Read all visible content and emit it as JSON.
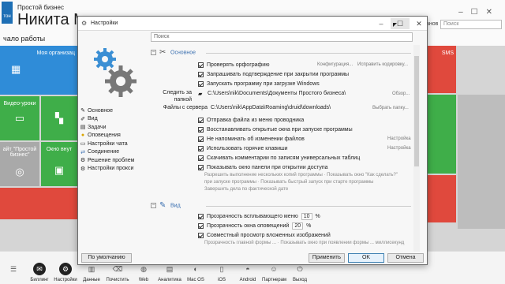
{
  "app": {
    "subtitle": "Простой бизнес",
    "name": "Никита М",
    "start": "чало работы",
    "logo_text": "тон",
    "side_label": "анов",
    "side_search": "Поиск"
  },
  "tiles": {
    "org": "Моя организац",
    "video": "Видео-уроки",
    "about": "айт \"Простой бизнес\"",
    "window": "Окно внут",
    "sms": "SMS"
  },
  "taskbar": [
    "Биллинг",
    "Настройки",
    "Данные",
    "Почистить",
    "Web",
    "Аналитика",
    "Mac OS",
    "iOS",
    "Android",
    "Партнерам",
    "Выход"
  ],
  "dialog": {
    "title": "Настройки",
    "search_placeholder": "Поиск",
    "nav": [
      {
        "label": "Основное",
        "icon": "wrench-icon"
      },
      {
        "label": "Вид",
        "icon": "brush-icon"
      },
      {
        "label": "Задачи",
        "icon": "task-icon"
      },
      {
        "label": "Оповещения",
        "icon": "bell-icon"
      },
      {
        "label": "Настройки чата",
        "icon": "chat-icon"
      },
      {
        "label": "Соединение",
        "icon": "connection-icon"
      },
      {
        "label": "Решение проблем",
        "icon": "gear-icon"
      },
      {
        "label": "Настройки прокси",
        "icon": "proxy-icon"
      }
    ],
    "sections": {
      "main": "Основное",
      "view": "Вид"
    },
    "options": [
      {
        "label": "Проверять орфографию",
        "checked": true
      },
      {
        "label": "Запрашивать подтверждение при закрытии программы",
        "checked": true
      },
      {
        "label": "Запускать программу при загрузке Windows",
        "checked": true
      },
      {
        "label": "Отправка файла из меню проводника",
        "checked": true
      },
      {
        "label": "Восстанавливать открытые окна при запуске программы",
        "checked": true
      },
      {
        "label": "Не напоминать об изменении файлов",
        "checked": true
      },
      {
        "label": "Использовать горячие клавиши",
        "checked": true
      },
      {
        "label": "Скачивать комментарии по записям универсальных таблиц",
        "checked": true
      },
      {
        "label": "Показывать окно панели при открытии доступа",
        "checked": true
      }
    ],
    "hints": {
      "spell_config": "Конфигурация...",
      "spell_fix": "Исправить кодировку...",
      "browse": "Обзор...",
      "choose_folder": "Выбрать папку...",
      "setting1": "Настройка",
      "setting2": "Настройка"
    },
    "folder_label": "Следить за папкой",
    "folder_path": "C:\\Users\\nik\\Documents\\Документы Простого бизнеса\\",
    "files_label": "Файлы с сервера",
    "files_path": "C:\\Users\\nik\\AppData\\Roaming\\druid\\downloads\\",
    "panel_subs": [
      "Разрешить выполнение нескольких копий программы · Показывать окно \"Как сделать?\"",
      "при запуске программы · Показывать быстрый запуск при старте программы",
      "Завершить дела по фактической дате"
    ],
    "view_options": [
      {
        "label_before": "Прозрачность всплывающего меню",
        "value": "10",
        "unit": "%",
        "checked": true
      },
      {
        "label_before": "Прозрачность окна оповещений",
        "value": "20",
        "unit": "%",
        "checked": true
      },
      {
        "label_before": "Совместный просмотр вложенных изображений",
        "checked": true
      }
    ],
    "view_sub": "Прозрачность главной формы ...  · Показывать окно при появлении формы ... миллисекунд",
    "buttons": {
      "default": "По умолчанию",
      "apply": "Применить",
      "ok": "OK",
      "cancel": "Отмена"
    }
  },
  "colors": {
    "tile_blue": "#2f8cd8",
    "tile_green": "#3fae49",
    "tile_red": "#e0493d",
    "tile_gray": "#a9a9a9",
    "section_blue": "#3a6fb0"
  }
}
